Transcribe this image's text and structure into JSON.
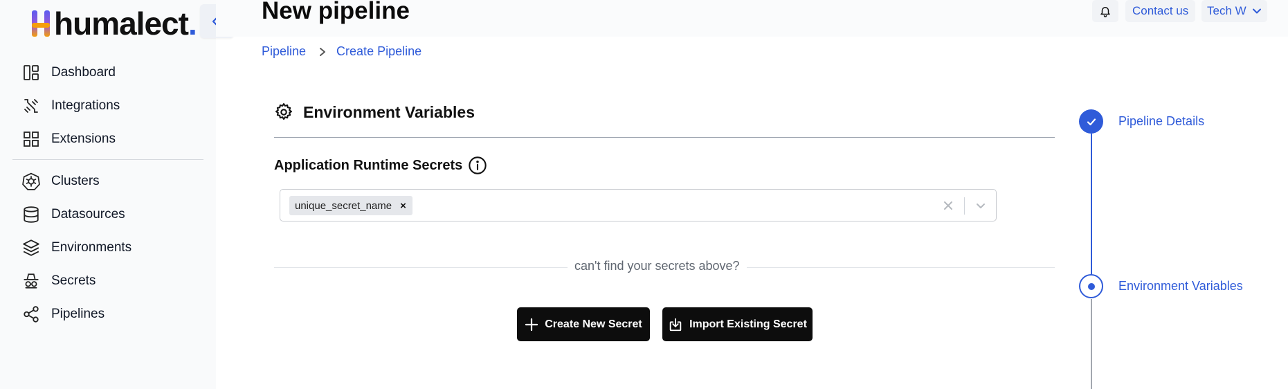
{
  "brand": {
    "name": "humalect",
    "dot": ".",
    "logo_letter": "h"
  },
  "sidebar": {
    "collapse_icon": "double-chevron-left-icon",
    "items": [
      {
        "label": "Dashboard",
        "icon": "dashboard-icon"
      },
      {
        "label": "Integrations",
        "icon": "integrations-icon"
      },
      {
        "label": "Extensions",
        "icon": "extensions-icon"
      },
      {
        "label": "Clusters",
        "icon": "clusters-icon"
      },
      {
        "label": "Datasources",
        "icon": "datasources-icon"
      },
      {
        "label": "Environments",
        "icon": "environments-icon"
      },
      {
        "label": "Secrets",
        "icon": "secrets-icon"
      },
      {
        "label": "Pipelines",
        "icon": "pipelines-icon"
      }
    ]
  },
  "header": {
    "title": "New pipeline",
    "contact_label": "Contact us",
    "user_label": "Tech W"
  },
  "breadcrumb": {
    "items": [
      "Pipeline",
      "Create Pipeline"
    ]
  },
  "section": {
    "title": "Environment Variables",
    "subtitle": "Application Runtime Secrets",
    "selected_secrets": [
      "unique_secret_name"
    ],
    "chip_remove": "×",
    "not_found_text": "can't find your secrets above?",
    "create_button": "Create New Secret",
    "import_button": "Import Existing Secret"
  },
  "stepper": {
    "steps": [
      {
        "label": "Pipeline Details",
        "state": "completed"
      },
      {
        "label": "Environment Variables",
        "state": "current"
      }
    ]
  },
  "colors": {
    "accent": "#2f5bd9",
    "button": "#0d0d0d"
  }
}
